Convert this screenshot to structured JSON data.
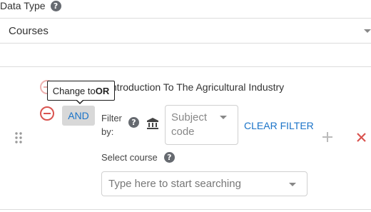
{
  "data_type": {
    "label": "Data Type",
    "help_icon": "question-circle-icon",
    "selected": "Courses"
  },
  "filters": {
    "course_value": "Introduction To The Agricultural Industry",
    "tooltip": {
      "prefix": "Change to ",
      "strong": "OR"
    },
    "operator_label": "AND",
    "filter_by_label": "Filter by:",
    "institution_icon": "bank-icon",
    "subject_select_placeholder": "Subject code",
    "clear_filter_label": "CLEAR FILTER",
    "select_course_label": "Select course",
    "search_placeholder": "Type here to start searching",
    "colors": {
      "accent": "#1a73c8",
      "danger": "#d9534f",
      "tooltip_border": "#1a1a1a"
    }
  }
}
